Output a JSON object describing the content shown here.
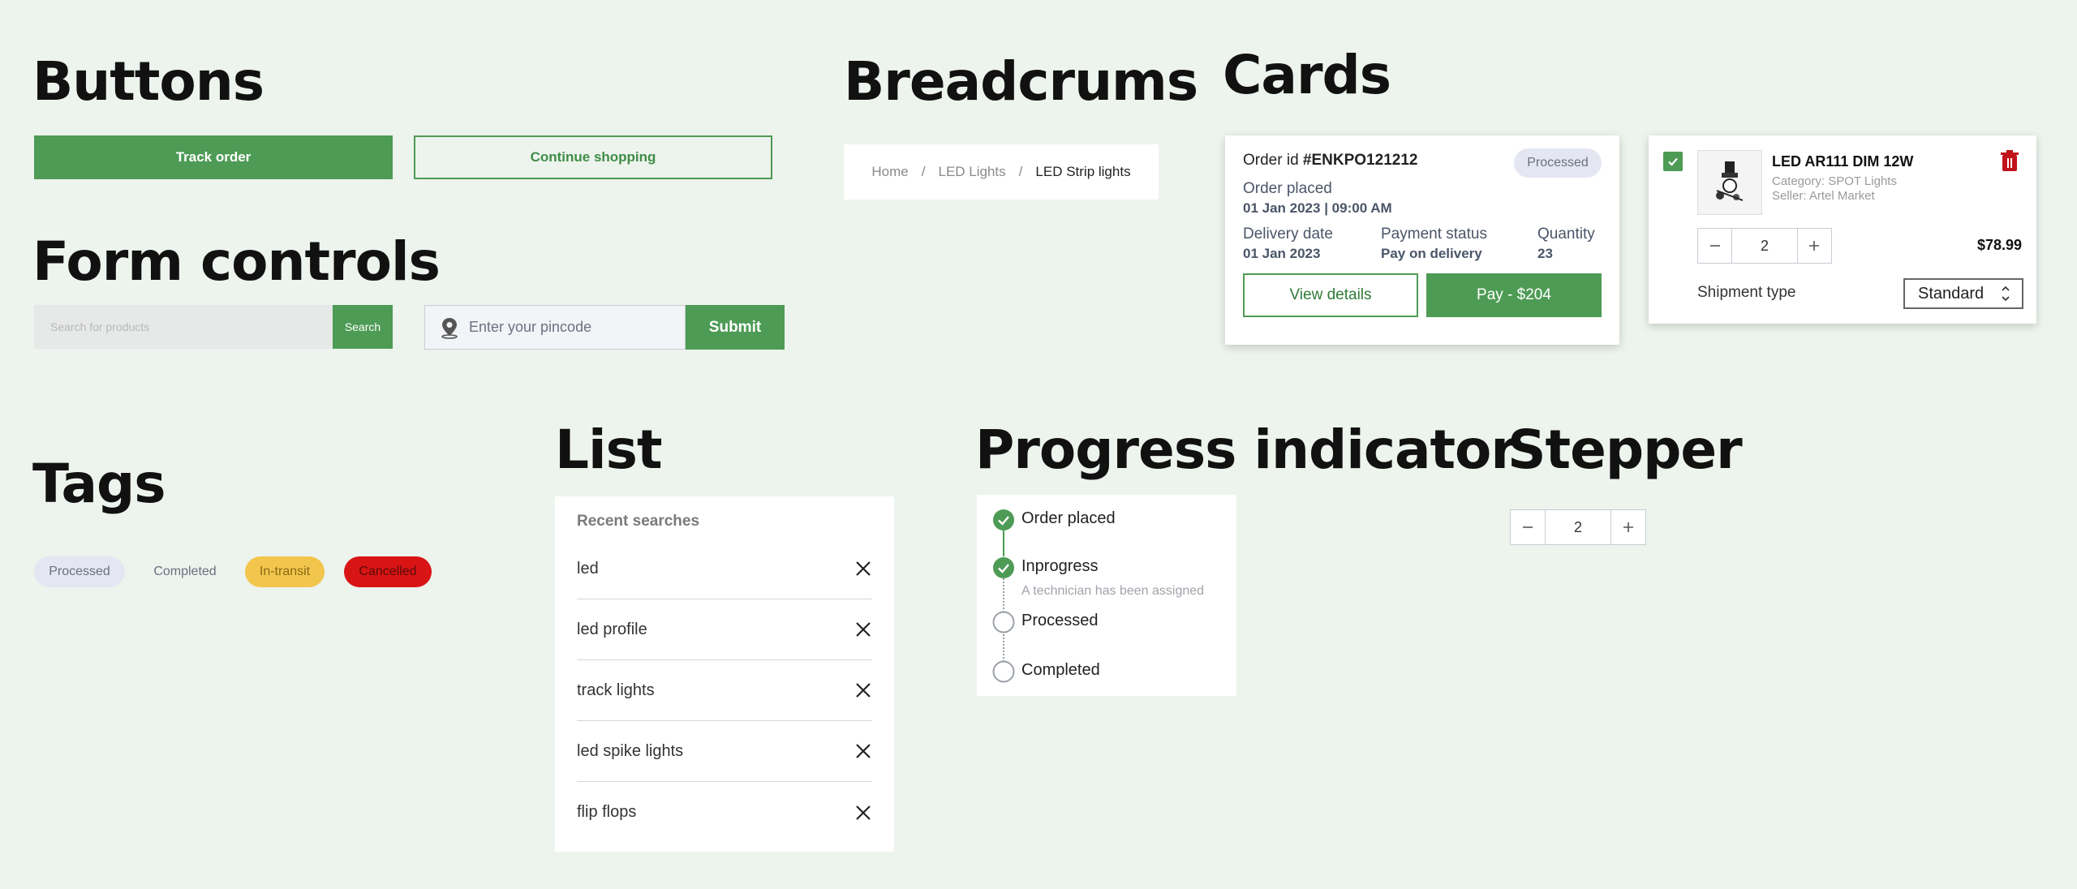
{
  "sections": {
    "buttons": "Buttons",
    "breadcrumbs": "Breadcrums",
    "cards": "Cards",
    "form_controls": "Form controls",
    "tags": "Tags",
    "list": "List",
    "progress": "Progress indicator",
    "stepper": "Stepper"
  },
  "buttons": {
    "primary": "Track order",
    "secondary": "Continue shopping"
  },
  "breadcrumb": {
    "items": [
      "Home",
      "LED Lights",
      "LED Strip lights"
    ],
    "separator": "/"
  },
  "form": {
    "search_placeholder": "Search for products",
    "search_button": "Search",
    "pincode_placeholder": "Enter your pincode",
    "submit_button": "Submit"
  },
  "order_card": {
    "order_label": "Order id",
    "order_id": "#ENKPO121212",
    "status": "Processed",
    "placed_label": "Order placed",
    "placed_value": "01 Jan 2023 | 09:00 AM",
    "delivery_label": "Delivery date",
    "delivery_value": "01 Jan 2023",
    "payment_label": "Payment status",
    "payment_value": "Pay on delivery",
    "quantity_label": "Quantity",
    "quantity_value": "23",
    "view_button": "View details",
    "pay_button": "Pay - $204"
  },
  "product_card": {
    "title": "LED AR111 DIM 12W",
    "category": "Category: SPOT Lights",
    "seller": "Seller: Artel Market",
    "quantity": "2",
    "price": "$78.99",
    "shipment_label": "Shipment type",
    "shipment_value": "Standard",
    "checked": true
  },
  "tags": [
    "Processed",
    "Completed",
    "In-transit",
    "Cancelled"
  ],
  "list": {
    "heading": "Recent searches",
    "items": [
      "led",
      "led profile",
      "track lights",
      "led spike lights",
      "flip flops"
    ]
  },
  "progress": {
    "steps": [
      {
        "label": "Order placed",
        "done": true
      },
      {
        "label": "Inprogress",
        "done": true,
        "note": "A technician has been assigned"
      },
      {
        "label": "Processed",
        "done": false
      },
      {
        "label": "Completed",
        "done": false
      }
    ]
  },
  "stepper": {
    "value": "2"
  },
  "colors": {
    "brand_green": "#4e9b55",
    "background": "#edf3ed",
    "tag_processed": "#e4e6f2",
    "tag_transit": "#f2c54c",
    "tag_cancelled": "#d81414",
    "delete_red": "#c0141a"
  }
}
